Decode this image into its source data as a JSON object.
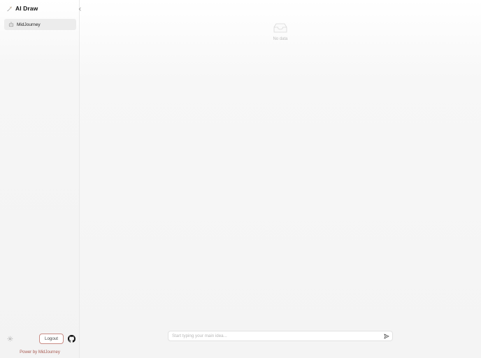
{
  "app": {
    "title": "AI Draw",
    "logo_icon": "paint-brush-icon"
  },
  "sidebar": {
    "collapse_icon": "chevron-left-icon",
    "items": [
      {
        "label": "MidJourney",
        "icon": "robot-icon",
        "active": true
      }
    ],
    "footer": {
      "settings_icon": "gear-icon",
      "logout_label": "Logout",
      "github_icon": "github-icon",
      "powered_by": "Power by MidJourney"
    }
  },
  "main": {
    "empty": {
      "icon": "empty-inbox-icon",
      "text": "No data"
    },
    "prompt": {
      "placeholder": "Start typing your main idea...",
      "value": "",
      "send_icon": "send-icon"
    }
  },
  "colors": {
    "logout_border": "#c98d86",
    "powered_text": "#a85b52",
    "active_item_bg": "#ececec"
  }
}
